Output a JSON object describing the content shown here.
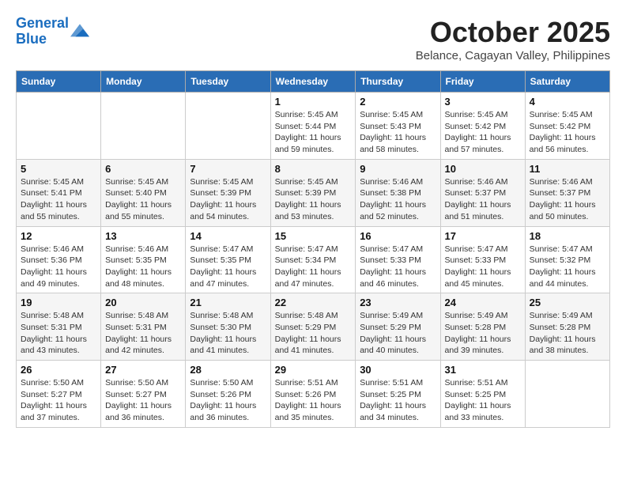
{
  "header": {
    "logo_line1": "General",
    "logo_line2": "Blue",
    "month": "October 2025",
    "location": "Belance, Cagayan Valley, Philippines"
  },
  "weekdays": [
    "Sunday",
    "Monday",
    "Tuesday",
    "Wednesday",
    "Thursday",
    "Friday",
    "Saturday"
  ],
  "weeks": [
    [
      {
        "day": "",
        "sunrise": "",
        "sunset": "",
        "daylight": ""
      },
      {
        "day": "",
        "sunrise": "",
        "sunset": "",
        "daylight": ""
      },
      {
        "day": "",
        "sunrise": "",
        "sunset": "",
        "daylight": ""
      },
      {
        "day": "1",
        "sunrise": "Sunrise: 5:45 AM",
        "sunset": "Sunset: 5:44 PM",
        "daylight": "Daylight: 11 hours and 59 minutes."
      },
      {
        "day": "2",
        "sunrise": "Sunrise: 5:45 AM",
        "sunset": "Sunset: 5:43 PM",
        "daylight": "Daylight: 11 hours and 58 minutes."
      },
      {
        "day": "3",
        "sunrise": "Sunrise: 5:45 AM",
        "sunset": "Sunset: 5:42 PM",
        "daylight": "Daylight: 11 hours and 57 minutes."
      },
      {
        "day": "4",
        "sunrise": "Sunrise: 5:45 AM",
        "sunset": "Sunset: 5:42 PM",
        "daylight": "Daylight: 11 hours and 56 minutes."
      }
    ],
    [
      {
        "day": "5",
        "sunrise": "Sunrise: 5:45 AM",
        "sunset": "Sunset: 5:41 PM",
        "daylight": "Daylight: 11 hours and 55 minutes."
      },
      {
        "day": "6",
        "sunrise": "Sunrise: 5:45 AM",
        "sunset": "Sunset: 5:40 PM",
        "daylight": "Daylight: 11 hours and 55 minutes."
      },
      {
        "day": "7",
        "sunrise": "Sunrise: 5:45 AM",
        "sunset": "Sunset: 5:39 PM",
        "daylight": "Daylight: 11 hours and 54 minutes."
      },
      {
        "day": "8",
        "sunrise": "Sunrise: 5:45 AM",
        "sunset": "Sunset: 5:39 PM",
        "daylight": "Daylight: 11 hours and 53 minutes."
      },
      {
        "day": "9",
        "sunrise": "Sunrise: 5:46 AM",
        "sunset": "Sunset: 5:38 PM",
        "daylight": "Daylight: 11 hours and 52 minutes."
      },
      {
        "day": "10",
        "sunrise": "Sunrise: 5:46 AM",
        "sunset": "Sunset: 5:37 PM",
        "daylight": "Daylight: 11 hours and 51 minutes."
      },
      {
        "day": "11",
        "sunrise": "Sunrise: 5:46 AM",
        "sunset": "Sunset: 5:37 PM",
        "daylight": "Daylight: 11 hours and 50 minutes."
      }
    ],
    [
      {
        "day": "12",
        "sunrise": "Sunrise: 5:46 AM",
        "sunset": "Sunset: 5:36 PM",
        "daylight": "Daylight: 11 hours and 49 minutes."
      },
      {
        "day": "13",
        "sunrise": "Sunrise: 5:46 AM",
        "sunset": "Sunset: 5:35 PM",
        "daylight": "Daylight: 11 hours and 48 minutes."
      },
      {
        "day": "14",
        "sunrise": "Sunrise: 5:47 AM",
        "sunset": "Sunset: 5:35 PM",
        "daylight": "Daylight: 11 hours and 47 minutes."
      },
      {
        "day": "15",
        "sunrise": "Sunrise: 5:47 AM",
        "sunset": "Sunset: 5:34 PM",
        "daylight": "Daylight: 11 hours and 47 minutes."
      },
      {
        "day": "16",
        "sunrise": "Sunrise: 5:47 AM",
        "sunset": "Sunset: 5:33 PM",
        "daylight": "Daylight: 11 hours and 46 minutes."
      },
      {
        "day": "17",
        "sunrise": "Sunrise: 5:47 AM",
        "sunset": "Sunset: 5:33 PM",
        "daylight": "Daylight: 11 hours and 45 minutes."
      },
      {
        "day": "18",
        "sunrise": "Sunrise: 5:47 AM",
        "sunset": "Sunset: 5:32 PM",
        "daylight": "Daylight: 11 hours and 44 minutes."
      }
    ],
    [
      {
        "day": "19",
        "sunrise": "Sunrise: 5:48 AM",
        "sunset": "Sunset: 5:31 PM",
        "daylight": "Daylight: 11 hours and 43 minutes."
      },
      {
        "day": "20",
        "sunrise": "Sunrise: 5:48 AM",
        "sunset": "Sunset: 5:31 PM",
        "daylight": "Daylight: 11 hours and 42 minutes."
      },
      {
        "day": "21",
        "sunrise": "Sunrise: 5:48 AM",
        "sunset": "Sunset: 5:30 PM",
        "daylight": "Daylight: 11 hours and 41 minutes."
      },
      {
        "day": "22",
        "sunrise": "Sunrise: 5:48 AM",
        "sunset": "Sunset: 5:29 PM",
        "daylight": "Daylight: 11 hours and 41 minutes."
      },
      {
        "day": "23",
        "sunrise": "Sunrise: 5:49 AM",
        "sunset": "Sunset: 5:29 PM",
        "daylight": "Daylight: 11 hours and 40 minutes."
      },
      {
        "day": "24",
        "sunrise": "Sunrise: 5:49 AM",
        "sunset": "Sunset: 5:28 PM",
        "daylight": "Daylight: 11 hours and 39 minutes."
      },
      {
        "day": "25",
        "sunrise": "Sunrise: 5:49 AM",
        "sunset": "Sunset: 5:28 PM",
        "daylight": "Daylight: 11 hours and 38 minutes."
      }
    ],
    [
      {
        "day": "26",
        "sunrise": "Sunrise: 5:50 AM",
        "sunset": "Sunset: 5:27 PM",
        "daylight": "Daylight: 11 hours and 37 minutes."
      },
      {
        "day": "27",
        "sunrise": "Sunrise: 5:50 AM",
        "sunset": "Sunset: 5:27 PM",
        "daylight": "Daylight: 11 hours and 36 minutes."
      },
      {
        "day": "28",
        "sunrise": "Sunrise: 5:50 AM",
        "sunset": "Sunset: 5:26 PM",
        "daylight": "Daylight: 11 hours and 36 minutes."
      },
      {
        "day": "29",
        "sunrise": "Sunrise: 5:51 AM",
        "sunset": "Sunset: 5:26 PM",
        "daylight": "Daylight: 11 hours and 35 minutes."
      },
      {
        "day": "30",
        "sunrise": "Sunrise: 5:51 AM",
        "sunset": "Sunset: 5:25 PM",
        "daylight": "Daylight: 11 hours and 34 minutes."
      },
      {
        "day": "31",
        "sunrise": "Sunrise: 5:51 AM",
        "sunset": "Sunset: 5:25 PM",
        "daylight": "Daylight: 11 hours and 33 minutes."
      },
      {
        "day": "",
        "sunrise": "",
        "sunset": "",
        "daylight": ""
      }
    ]
  ]
}
